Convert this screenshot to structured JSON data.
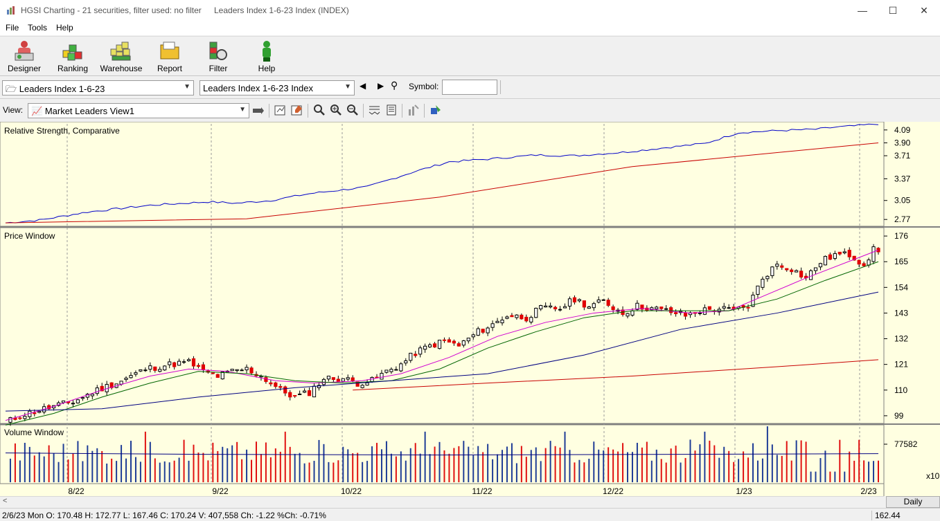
{
  "window": {
    "app_title": "HGSI Charting - 21 securities, filter used: no filter",
    "doc_title": "Leaders Index 1-6-23 Index (INDEX)",
    "minimize": "—",
    "maximize": "☐",
    "close": "✕"
  },
  "menu": [
    "File",
    "Tools",
    "Help"
  ],
  "toolbar": [
    {
      "label": "Designer",
      "icon": "designer-icon"
    },
    {
      "label": "Ranking",
      "icon": "ranking-icon"
    },
    {
      "label": "Warehouse",
      "icon": "warehouse-icon"
    },
    {
      "label": "Report",
      "icon": "report-icon"
    },
    {
      "label": "Filter",
      "icon": "filter-icon"
    },
    {
      "label": "Help",
      "icon": "help-icon"
    }
  ],
  "selectors": {
    "folder_value": "Leaders Index 1-6-23",
    "security_value": "Leaders Index 1-6-23 Index",
    "symbol_label": "Symbol:",
    "symbol_value": "",
    "view_label": "View:",
    "view_value": "Market Leaders View1"
  },
  "panels": {
    "rs_title": "Relative Strength, Comparative",
    "price_title": "Price Window",
    "volume_title": "Volume Window"
  },
  "axes": {
    "rs_ticks": [
      "4.09",
      "3.90",
      "3.71",
      "3.37",
      "3.05",
      "2.77"
    ],
    "price_ticks": [
      "176",
      "165",
      "154",
      "143",
      "132",
      "121",
      "110",
      "99"
    ],
    "volume_ticks": [
      "77582"
    ],
    "volume_multiplier": "x10",
    "date_ticks": [
      "8/22",
      "9/22",
      "10/22",
      "11/22",
      "12/22",
      "1/23",
      "2/23"
    ]
  },
  "colors": {
    "up": "#ffffff",
    "down": "#e00000",
    "rs_line": "#0000c8",
    "rs_avg": "#c80000",
    "ma_short": "#d000d0",
    "ma_mid": "#006400",
    "ma_long": "#000080",
    "ma_longest": "#c80000",
    "vol_up": "#1e3c96",
    "vol_down": "#e01010",
    "panel_bg": "#ffffe1"
  },
  "period": "Daily",
  "status": {
    "text": "2/6/23 Mon O: 170.48 H: 172.77 L: 167.46 C: 170.24 V: 407,558 Ch: -1.22 %Ch: -0.71%",
    "value": "162.44"
  },
  "chart_data": {
    "type": "candlestick",
    "x_range": [
      "2022-07-11",
      "2023-02-06"
    ],
    "price_ylim": [
      96,
      179
    ],
    "rs_ylim": [
      2.68,
      4.18
    ],
    "x_ticks": [
      "8/22",
      "9/22",
      "10/22",
      "11/22",
      "12/22",
      "1/23",
      "2/23"
    ],
    "price_anchors": [
      [
        0,
        96
      ],
      [
        3,
        99
      ],
      [
        8,
        102
      ],
      [
        14,
        105
      ],
      [
        19,
        110
      ],
      [
        24,
        114
      ],
      [
        29,
        119
      ],
      [
        34,
        121
      ],
      [
        38,
        122
      ],
      [
        41,
        118
      ],
      [
        44,
        116
      ],
      [
        47,
        118
      ],
      [
        50,
        119
      ],
      [
        53,
        116
      ],
      [
        57,
        110
      ],
      [
        60,
        107
      ],
      [
        63,
        109
      ],
      [
        66,
        115
      ],
      [
        70,
        115
      ],
      [
        73,
        113
      ],
      [
        76,
        114
      ],
      [
        79,
        118
      ],
      [
        82,
        121
      ],
      [
        85,
        126
      ],
      [
        88,
        129
      ],
      [
        91,
        131
      ],
      [
        94,
        129
      ],
      [
        98,
        135
      ],
      [
        101,
        138
      ],
      [
        104,
        142
      ],
      [
        108,
        141
      ],
      [
        111,
        145
      ],
      [
        115,
        145
      ],
      [
        118,
        149
      ],
      [
        121,
        146
      ],
      [
        124,
        148
      ],
      [
        128,
        143
      ],
      [
        131,
        146
      ],
      [
        134,
        145
      ],
      [
        137,
        144
      ],
      [
        141,
        142
      ],
      [
        144,
        144
      ],
      [
        148,
        145
      ],
      [
        151,
        144
      ],
      [
        154,
        146
      ],
      [
        157,
        158
      ],
      [
        160,
        164
      ],
      [
        163,
        162
      ],
      [
        166,
        158
      ],
      [
        169,
        165
      ],
      [
        172,
        168
      ],
      [
        175,
        168
      ],
      [
        178,
        164
      ],
      [
        180,
        170
      ],
      [
        181,
        170
      ]
    ],
    "rs_line": [
      [
        0,
        2.72
      ],
      [
        7,
        2.76
      ],
      [
        17,
        2.88
      ],
      [
        30,
        2.98
      ],
      [
        42,
        3.03
      ],
      [
        48,
        3.01
      ],
      [
        55,
        3.05
      ],
      [
        63,
        3.15
      ],
      [
        75,
        3.25
      ],
      [
        85,
        3.48
      ],
      [
        92,
        3.62
      ],
      [
        100,
        3.66
      ],
      [
        110,
        3.72
      ],
      [
        118,
        3.71
      ],
      [
        128,
        3.76
      ],
      [
        137,
        3.83
      ],
      [
        145,
        3.89
      ],
      [
        152,
        4.05
      ],
      [
        160,
        4.08
      ],
      [
        168,
        4.1
      ],
      [
        172,
        4.13
      ],
      [
        176,
        4.15
      ],
      [
        181,
        4.18
      ]
    ],
    "rs_avg": [
      [
        0,
        2.72
      ],
      [
        50,
        2.78
      ],
      [
        90,
        3.1
      ],
      [
        130,
        3.55
      ],
      [
        181,
        3.9
      ]
    ],
    "moving_averages": [
      {
        "points": [
          [
            0,
            97
          ],
          [
            10,
            103
          ],
          [
            20,
            110
          ],
          [
            30,
            116
          ],
          [
            38,
            119
          ],
          [
            46,
            118
          ],
          [
            56,
            114
          ],
          [
            64,
            113
          ],
          [
            74,
            114
          ],
          [
            82,
            117
          ],
          [
            92,
            124
          ],
          [
            102,
            133
          ],
          [
            112,
            139
          ],
          [
            122,
            143
          ],
          [
            132,
            145
          ],
          [
            142,
            143
          ],
          [
            150,
            144
          ],
          [
            158,
            151
          ],
          [
            166,
            158
          ],
          [
            176,
            166
          ],
          [
            181,
            170
          ]
        ]
      },
      {
        "points": [
          [
            0,
            95
          ],
          [
            10,
            100
          ],
          [
            20,
            107
          ],
          [
            30,
            113
          ],
          [
            40,
            118
          ],
          [
            50,
            117
          ],
          [
            60,
            114
          ],
          [
            70,
            113
          ],
          [
            80,
            114
          ],
          [
            90,
            119
          ],
          [
            100,
            128
          ],
          [
            110,
            135
          ],
          [
            120,
            141
          ],
          [
            130,
            144
          ],
          [
            140,
            144
          ],
          [
            150,
            144
          ],
          [
            160,
            149
          ],
          [
            170,
            157
          ],
          [
            181,
            165
          ]
        ]
      },
      {
        "points": [
          [
            0,
            101
          ],
          [
            20,
            102
          ],
          [
            40,
            107
          ],
          [
            60,
            111
          ],
          [
            80,
            114
          ],
          [
            100,
            117
          ],
          [
            120,
            125
          ],
          [
            140,
            136
          ],
          [
            160,
            143
          ],
          [
            181,
            152
          ]
        ]
      },
      {
        "points": [
          [
            72,
            110
          ],
          [
            100,
            113
          ],
          [
            130,
            116
          ],
          [
            160,
            120
          ],
          [
            181,
            123
          ]
        ]
      }
    ],
    "volume_ylim": [
      0,
      77582
    ]
  }
}
